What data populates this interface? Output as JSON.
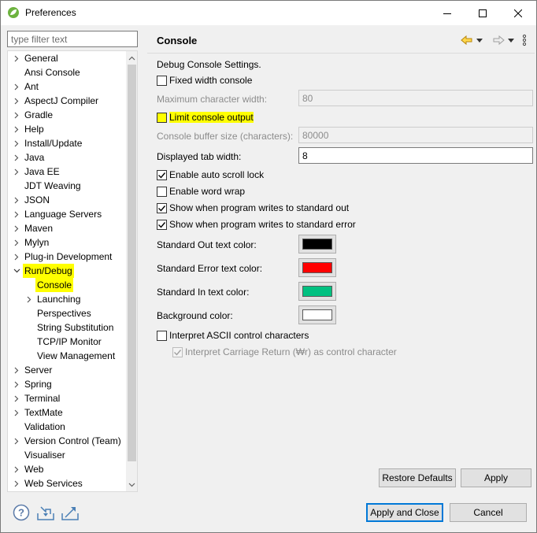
{
  "window": {
    "title": "Preferences"
  },
  "filter": {
    "placeholder": "type filter text"
  },
  "tree": {
    "items": [
      {
        "label": "General",
        "expandable": true,
        "depth": 0
      },
      {
        "label": "Ansi Console",
        "expandable": false,
        "depth": 0
      },
      {
        "label": "Ant",
        "expandable": true,
        "depth": 0
      },
      {
        "label": "AspectJ Compiler",
        "expandable": true,
        "depth": 0
      },
      {
        "label": "Gradle",
        "expandable": true,
        "depth": 0
      },
      {
        "label": "Help",
        "expandable": true,
        "depth": 0
      },
      {
        "label": "Install/Update",
        "expandable": true,
        "depth": 0
      },
      {
        "label": "Java",
        "expandable": true,
        "depth": 0
      },
      {
        "label": "Java EE",
        "expandable": true,
        "depth": 0
      },
      {
        "label": "JDT Weaving",
        "expandable": false,
        "depth": 0
      },
      {
        "label": "JSON",
        "expandable": true,
        "depth": 0
      },
      {
        "label": "Language Servers",
        "expandable": true,
        "depth": 0
      },
      {
        "label": "Maven",
        "expandable": true,
        "depth": 0
      },
      {
        "label": "Mylyn",
        "expandable": true,
        "depth": 0
      },
      {
        "label": "Plug-in Development",
        "expandable": true,
        "depth": 0
      },
      {
        "label": "Run/Debug",
        "expandable": true,
        "expanded": true,
        "depth": 0,
        "highlighted": true
      },
      {
        "label": "Console",
        "expandable": false,
        "depth": 1,
        "selected": true
      },
      {
        "label": "Launching",
        "expandable": true,
        "depth": 1
      },
      {
        "label": "Perspectives",
        "expandable": false,
        "depth": 1
      },
      {
        "label": "String Substitution",
        "expandable": false,
        "depth": 1
      },
      {
        "label": "TCP/IP Monitor",
        "expandable": false,
        "depth": 1
      },
      {
        "label": "View Management",
        "expandable": false,
        "depth": 1
      },
      {
        "label": "Server",
        "expandable": true,
        "depth": 0
      },
      {
        "label": "Spring",
        "expandable": true,
        "depth": 0
      },
      {
        "label": "Terminal",
        "expandable": true,
        "depth": 0
      },
      {
        "label": "TextMate",
        "expandable": true,
        "depth": 0
      },
      {
        "label": "Validation",
        "expandable": false,
        "depth": 0
      },
      {
        "label": "Version Control (Team)",
        "expandable": true,
        "depth": 0
      },
      {
        "label": "Visualiser",
        "expandable": false,
        "depth": 0
      },
      {
        "label": "Web",
        "expandable": true,
        "depth": 0
      },
      {
        "label": "Web Services",
        "expandable": true,
        "depth": 0
      }
    ]
  },
  "page": {
    "title": "Console",
    "section_label": "Debug Console Settings.",
    "fixed_width": {
      "label": "Fixed width console",
      "checked": false
    },
    "max_char_width": {
      "label": "Maximum character width:",
      "value": "80"
    },
    "limit_output": {
      "label": "Limit console output",
      "checked": false
    },
    "buffer_size": {
      "label": "Console buffer size (characters):",
      "value": "80000"
    },
    "tab_width": {
      "label": "Displayed tab width:",
      "value": "8"
    },
    "auto_scroll": {
      "label": "Enable auto scroll lock",
      "checked": true
    },
    "word_wrap": {
      "label": "Enable word wrap",
      "checked": false
    },
    "show_out": {
      "label": "Show when program writes to standard out",
      "checked": true
    },
    "show_err": {
      "label": "Show when program writes to standard error",
      "checked": true
    },
    "colors": {
      "out": {
        "label": "Standard Out text color:",
        "color": "#000000"
      },
      "err": {
        "label": "Standard Error text color:",
        "color": "#ff0000"
      },
      "in": {
        "label": "Standard In text color:",
        "color": "#00c080"
      },
      "bg": {
        "label": "Background color:",
        "color": "#ffffff"
      }
    },
    "ascii": {
      "label": "Interpret ASCII control characters",
      "checked": false
    },
    "carriage": {
      "label": "Interpret Carriage Return (₩r) as control character",
      "checked": true
    },
    "restore_defaults": "Restore Defaults",
    "apply": "Apply"
  },
  "footer": {
    "apply_close": "Apply and Close",
    "cancel": "Cancel"
  },
  "colors": {
    "highlight": "#ffff00",
    "accent": "#0078d7"
  }
}
